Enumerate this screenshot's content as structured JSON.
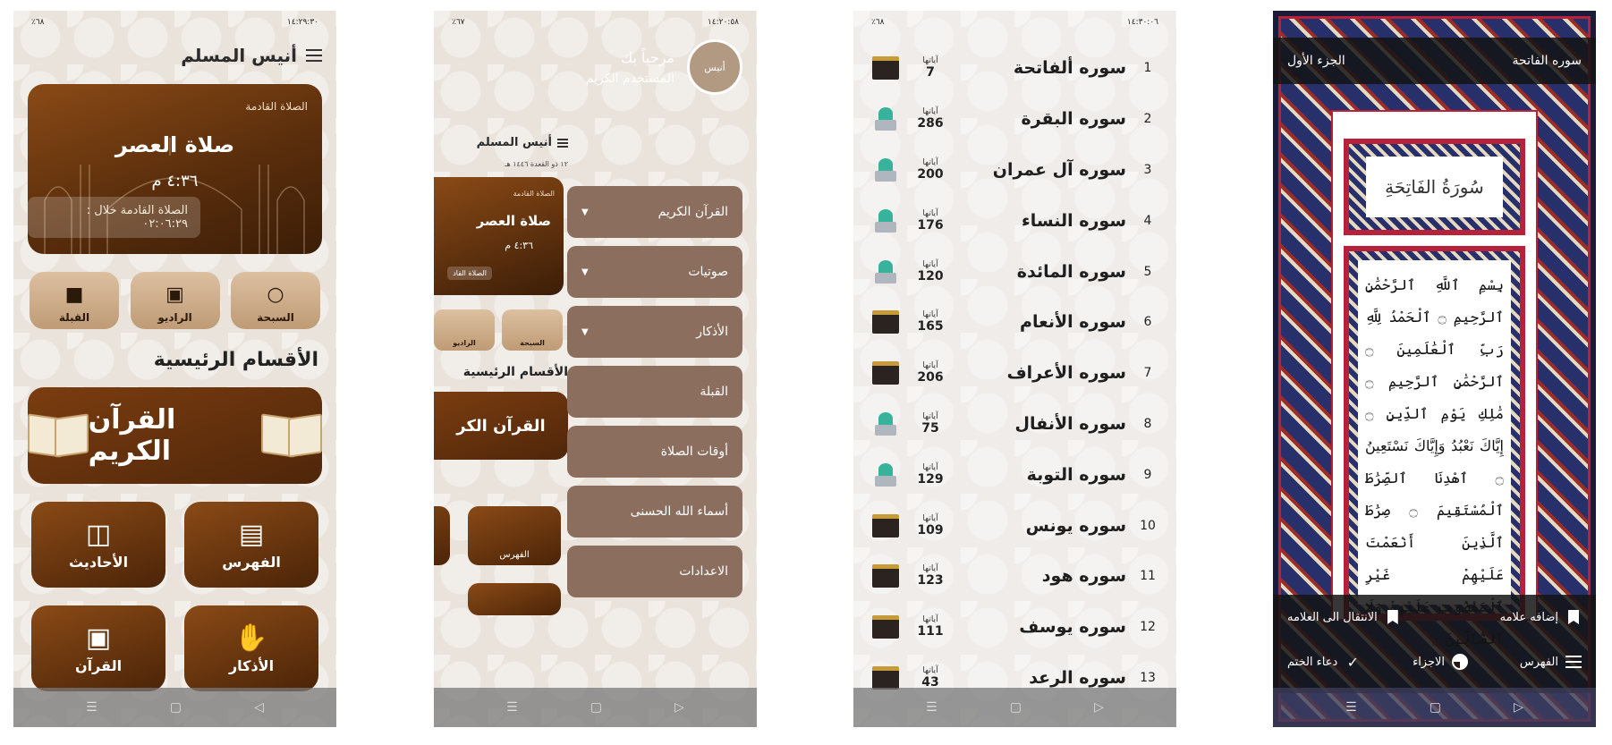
{
  "status": {
    "s1_time": "١٤:٢٩:٣٠",
    "s1_battery": "٪٦٨",
    "s2_time": "١٤:٢٠:٥٨",
    "s2_battery": "٪٦٧",
    "s3_time": "١٤:٣٠:٠٦",
    "s3_battery": "٪٦٨"
  },
  "home": {
    "app_title": "أنيس المسلم",
    "next_prayer_label": "الصلاة القادمة",
    "prayer_name": "صلاة العصر",
    "prayer_time": "٤:٣٦ م",
    "countdown": "الصلاة القادمة خلال : ٠٢:٠٦:٢٩",
    "quick": [
      {
        "label": "السبحة",
        "icon": "tasbih-icon"
      },
      {
        "label": "الراديو",
        "icon": "radio-icon"
      },
      {
        "label": "القبلة",
        "icon": "kaaba-icon"
      }
    ],
    "sections_title": "الأقسام الرئيسية",
    "quran_banner": "القرآن الكريم",
    "tiles": [
      {
        "label": "الفهرس",
        "icon": "notebook-icon"
      },
      {
        "label": "الأحاديث",
        "icon": "book-icon"
      },
      {
        "label": "الأذكار",
        "icon": "hands-icon"
      },
      {
        "label": "القرآن",
        "icon": "radio-icon"
      }
    ]
  },
  "drawer": {
    "welcome": "مرحباً بك",
    "user": "المستخدم الكريم",
    "logo_text": "أنيس",
    "menu": [
      {
        "label": "القرآن الكريم",
        "expandable": true
      },
      {
        "label": "صوتيات",
        "expandable": true
      },
      {
        "label": "الأذكار",
        "expandable": true
      },
      {
        "label": "القبلة",
        "expandable": false
      },
      {
        "label": "أوقات الصلاة",
        "expandable": false
      },
      {
        "label": "أسماء الله الحسنى",
        "expandable": false
      },
      {
        "label": "الاعدادات",
        "expandable": false
      }
    ],
    "peek_title": "أنيس المسلم",
    "peek_date": "١٢ ذو القعدة ١٤٤٦ هـ",
    "peek_next": "الصلاة القادمة",
    "peek_prayer": "صلاة العصر",
    "peek_time": "٤:٣٦ م",
    "peek_countdown": "الصلاة القاد",
    "peek_q1": "السبحة",
    "peek_q2": "الراديو",
    "peek_sections": "الأقسام الرئيسية",
    "peek_banner": "القرآن الكر",
    "peek_tile": "الفهرس"
  },
  "surahs": {
    "ayat_label": "آياتها",
    "list": [
      {
        "num": "1",
        "name": "سوره ألفاتحة",
        "ayat": "7",
        "type": "makki"
      },
      {
        "num": "2",
        "name": "سوره البقرة",
        "ayat": "286",
        "type": "madani"
      },
      {
        "num": "3",
        "name": "سوره آل عمران",
        "ayat": "200",
        "type": "madani"
      },
      {
        "num": "4",
        "name": "سوره النساء",
        "ayat": "176",
        "type": "madani"
      },
      {
        "num": "5",
        "name": "سوره المائدة",
        "ayat": "120",
        "type": "madani"
      },
      {
        "num": "6",
        "name": "سوره الأنعام",
        "ayat": "165",
        "type": "makki"
      },
      {
        "num": "7",
        "name": "سوره الأعراف",
        "ayat": "206",
        "type": "makki"
      },
      {
        "num": "8",
        "name": "سوره الأنفال",
        "ayat": "75",
        "type": "madani"
      },
      {
        "num": "9",
        "name": "سوره التوبة",
        "ayat": "129",
        "type": "madani"
      },
      {
        "num": "10",
        "name": "سوره يونس",
        "ayat": "109",
        "type": "makki"
      },
      {
        "num": "11",
        "name": "سوره هود",
        "ayat": "123",
        "type": "makki"
      },
      {
        "num": "12",
        "name": "سوره يوسف",
        "ayat": "111",
        "type": "makki"
      },
      {
        "num": "13",
        "name": "سوره الرعد",
        "ayat": "43",
        "type": "makki"
      }
    ]
  },
  "reader": {
    "surah": "سوره الفاتحة",
    "juz": "الجزء الأول",
    "surah_header": "سُورَةُ الفَاتِحَةِ",
    "verses": "بِسْمِ ٱللَّهِ ٱلرَّحْمَٰنِ ٱلرَّحِيمِ ۝ ٱلْحَمْدُ لِلَّهِ رَبِّ ٱلْعَٰلَمِينَ ۝ ٱلرَّحْمَٰنِ ٱلرَّحِيمِ ۝ مَٰلِكِ يَوْمِ ٱلدِّينِ ۝ إِيَّاكَ نَعْبُدُ وَإِيَّاكَ نَسْتَعِينُ ۝ ٱهْدِنَا ٱلصِّرَٰطَ ٱلْمُسْتَقِيمَ ۝ صِرَٰطَ ٱلَّذِينَ أَنْعَمْتَ عَلَيْهِمْ غَيْرِ ٱلْمَغْضُوبِ عَلَيْهِمْ وَلَا ٱلضَّآلِّينَ ۝",
    "add_bookmark": "إضافه علامه",
    "go_bookmark": "الانتقال الى العلامه",
    "index": "الفهرس",
    "parts": "الاجزاء",
    "dua": "دعاء الختم"
  }
}
